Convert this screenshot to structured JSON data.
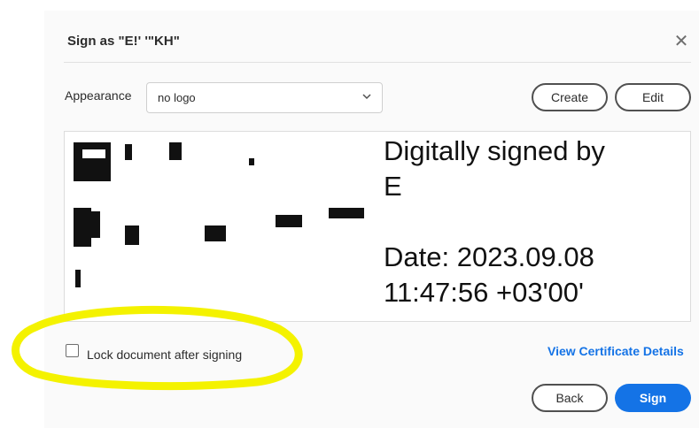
{
  "dialog": {
    "title": "Sign as \"E!'              '\"KH\"",
    "close_icon": "close-icon"
  },
  "appearance": {
    "label": "Appearance",
    "selected": "no logo",
    "create_label": "Create",
    "edit_label": "Edit"
  },
  "signature_preview": {
    "lines": [
      "Digitally signed by",
      "E",
      "",
      "Date: 2023.09.08",
      "11:47:56 +03'00'"
    ]
  },
  "options": {
    "lock_label": "Lock document after signing",
    "lock_checked": false
  },
  "links": {
    "view_certificate": "View Certificate Details"
  },
  "footer": {
    "back_label": "Back",
    "sign_label": "Sign"
  },
  "colors": {
    "accent": "#1473e6",
    "highlight": "#f4f200"
  }
}
